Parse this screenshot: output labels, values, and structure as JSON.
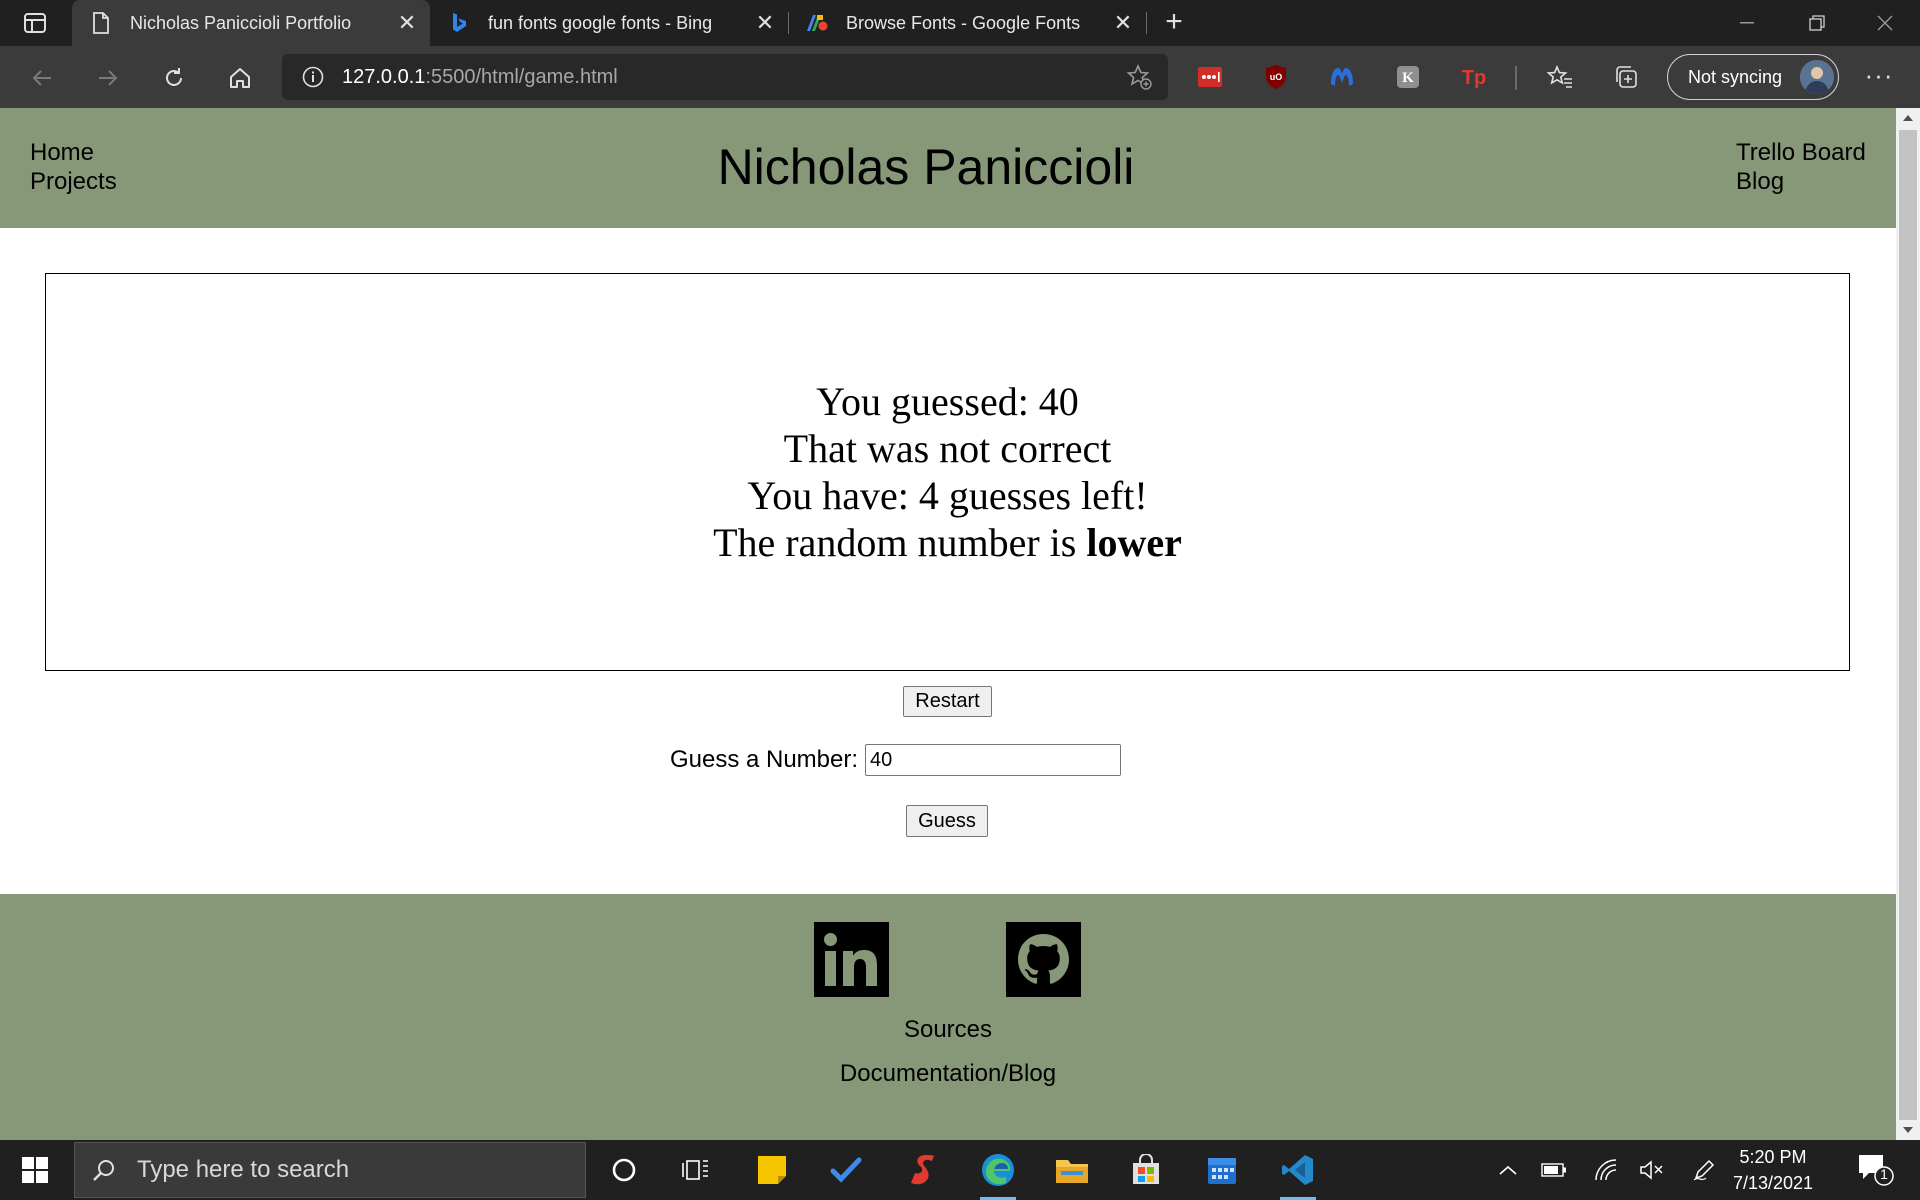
{
  "browser": {
    "tabs": [
      {
        "title": "Nicholas Paniccioli Portfolio",
        "active": true,
        "favicon": "page-icon"
      },
      {
        "title": "fun fonts google fonts - Bing",
        "active": false,
        "favicon": "bing-icon"
      },
      {
        "title": "Browse Fonts - Google Fonts",
        "active": false,
        "favicon": "google-fonts-icon"
      }
    ],
    "url_host": "127.0.0.1",
    "url_rest": ":5500/html/game.html",
    "sync_label": "Not syncing"
  },
  "site": {
    "title": "Nicholas Paniccioli",
    "nav_left": [
      "Home",
      "Projects"
    ],
    "nav_right": [
      "Trello Board",
      "Blog"
    ],
    "header_color": "#879878"
  },
  "game": {
    "line1": "You guessed: 40",
    "line2": "That was not correct",
    "line3": "You have: 4 guesses left!",
    "line4_prefix": "The random number is ",
    "line4_bold": "lower",
    "restart_label": "Restart",
    "guess_label": "Guess a Number:",
    "guess_value": "40",
    "guess_button": "Guess"
  },
  "footer": {
    "icons": [
      "linkedin-icon",
      "github-icon"
    ],
    "sources_label": "Sources",
    "docs_label": "Documentation/Blog"
  },
  "taskbar": {
    "search_placeholder": "Type here to search",
    "time": "5:20 PM",
    "date": "7/13/2021",
    "notification_count": "1"
  }
}
